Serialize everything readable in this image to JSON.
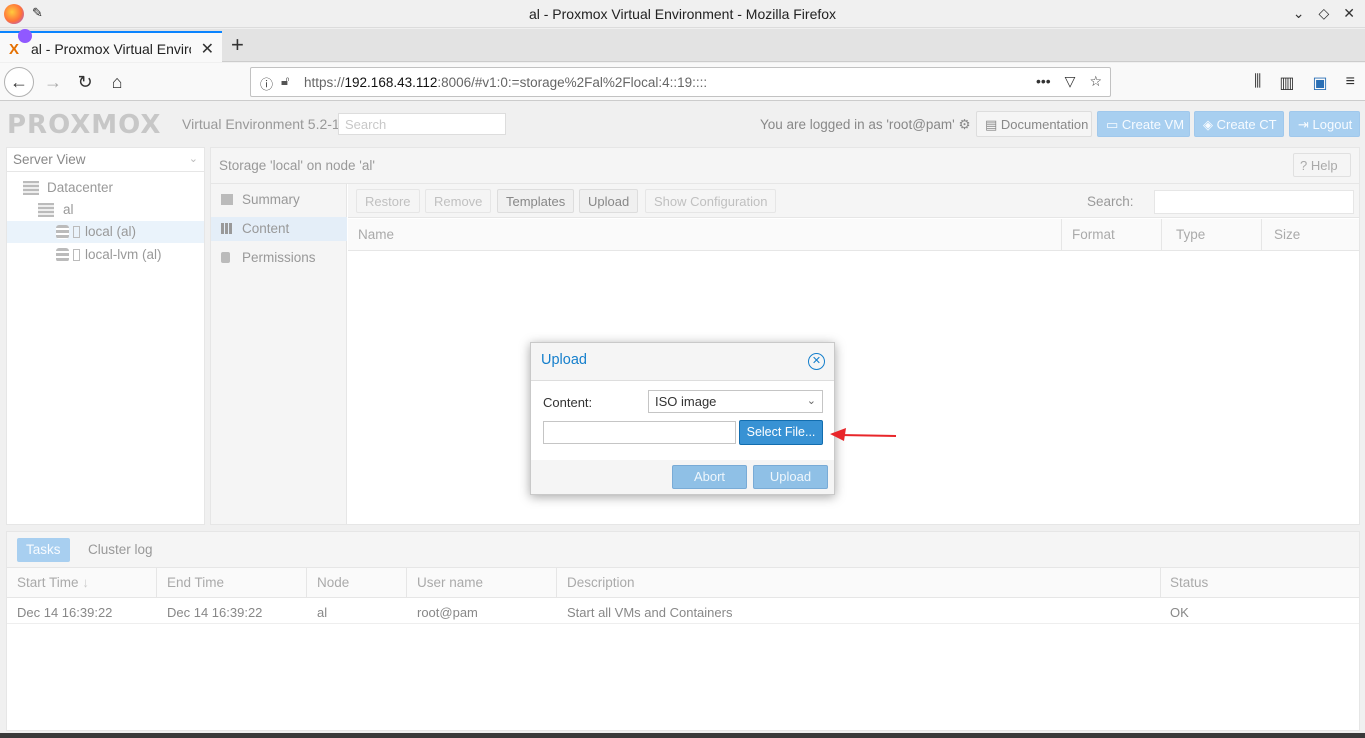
{
  "browser": {
    "window_title": "al - Proxmox Virtual Environment - Mozilla Firefox",
    "tab_label": "al - Proxmox Virtual Environment",
    "url_prefix": "https://",
    "url_host": "192.168.43.112",
    "url_rest": ":8006/#v1:0:=storage%2Fal%2Flocal:4::19::::"
  },
  "header": {
    "logo_text": "PROXMOX",
    "version": "Virtual Environment 5.2-1",
    "search_placeholder": "Search",
    "logged_in": "You are logged in as 'root@pam'",
    "documentation": "Documentation",
    "create_vm": "Create VM",
    "create_ct": "Create CT",
    "logout": "Logout"
  },
  "tree": {
    "view": "Server View",
    "items": [
      {
        "label": "Datacenter"
      },
      {
        "label": "al"
      },
      {
        "label": "local (al)"
      },
      {
        "label": "local-lvm (al)"
      }
    ]
  },
  "main": {
    "title": "Storage 'local' on node 'al'",
    "help": "Help",
    "nav": [
      {
        "label": "Summary"
      },
      {
        "label": "Content"
      },
      {
        "label": "Permissions"
      }
    ],
    "toolbar": {
      "restore": "Restore",
      "remove": "Remove",
      "templates": "Templates",
      "upload": "Upload",
      "show_config": "Show Configuration",
      "search_label": "Search:"
    },
    "columns": [
      "Name",
      "Format",
      "Type",
      "Size"
    ]
  },
  "dialog": {
    "title": "Upload",
    "content_label": "Content:",
    "content_value": "ISO image",
    "select_file": "Select File...",
    "abort": "Abort",
    "upload": "Upload"
  },
  "tasks": {
    "tabs": [
      "Tasks",
      "Cluster log"
    ],
    "columns": [
      "Start Time",
      "End Time",
      "Node",
      "User name",
      "Description",
      "Status"
    ],
    "rows": [
      {
        "start": "Dec 14 16:39:22",
        "end": "Dec 14 16:39:22",
        "node": "al",
        "user": "root@pam",
        "description": "Start all VMs and Containers",
        "status": "OK"
      }
    ]
  },
  "colors": {
    "accent": "#157fcc",
    "primary_button": "#3892d4",
    "annotation_arrow": "#e8262a"
  }
}
